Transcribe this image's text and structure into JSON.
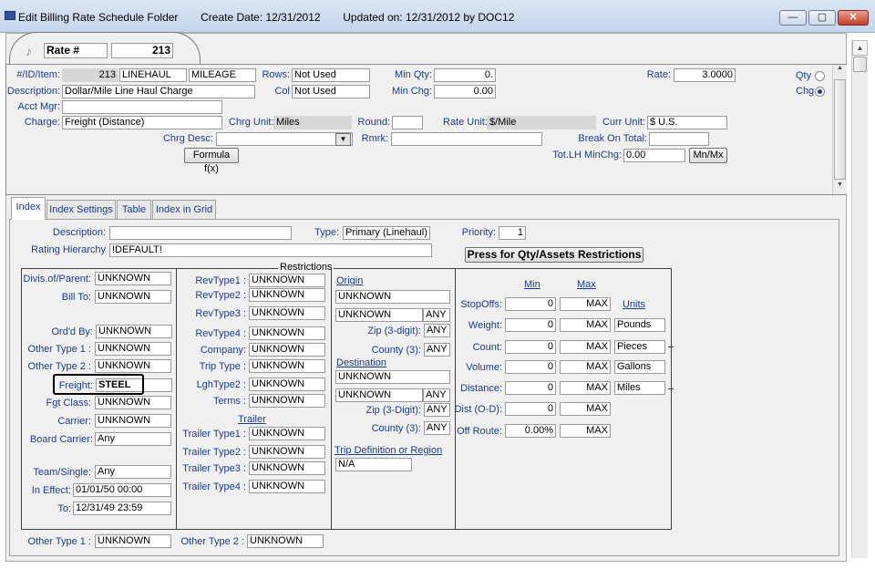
{
  "window": {
    "title": "Edit Billing Rate Schedule Folder",
    "create_date": "Create Date: 12/31/2012",
    "updated": "Updated on: 12/31/2012  by  DOC12",
    "min": "—",
    "max": "▢",
    "close": "✕"
  },
  "rate_tab": {
    "label": "Rate #",
    "value": "213"
  },
  "header": {
    "id_item_label": "#/ID/Item:",
    "id_num": "213",
    "id_name": "LINEHAUL",
    "item": "MILEAGE",
    "rows_label": "Rows:",
    "rows_value": "Not Used",
    "min_qty_label": "Min Qty:",
    "min_qty_value": "0.",
    "rate_label": "Rate:",
    "rate_value": "3.0000",
    "qty_label": "Qty",
    "chg_label": "Chg",
    "desc_label": "Description:",
    "desc_value": "Dollar/Mile Line Haul Charge",
    "col_label": "Col",
    "col_value": "Not Used",
    "min_chg_label": "Min Chg:",
    "min_chg_value": "0.00",
    "acct_mgr_label": "Acct Mgr:",
    "acct_mgr_value": "",
    "charge_label": "Charge:",
    "charge_value": "Freight (Distance)",
    "chrg_unit_label": "Chrg Unit:",
    "chrg_unit_value": "Miles",
    "round_label": "Round:",
    "round_value": "",
    "rate_unit_label": "Rate Unit:",
    "rate_unit_value": "$/Mile",
    "curr_unit_label": "Curr Unit:",
    "curr_unit_value": "$ U.S.",
    "chrg_desc_label": "Chrg Desc:",
    "chrg_desc_value": "",
    "rmrk_label": "Rmrk:",
    "rmrk_value": "",
    "break_on_total_label": "Break On Total:",
    "break_on_total_value": "",
    "formula_btn": "Formula f(x)",
    "tot_lh_label": "Tot.LH MinChg:",
    "tot_lh_value": "0.00",
    "mnmx_btn": "Mn/Mx"
  },
  "tabs": [
    "Index",
    "Index Settings",
    "Table",
    "Index in Grid"
  ],
  "index": {
    "description_label": "Description:",
    "description_value": "",
    "type_label": "Type:",
    "type_value": "Primary (Linehaul)",
    "priority_label": "Priority:",
    "priority_value": "1",
    "rating_hierarchy_label": "Rating Hierarchy",
    "rating_hierarchy_value": "!DEFAULT!",
    "press_btn": "Press for Qty/Assets Restrictions",
    "restrictions_label": "Restrictions",
    "col1": [
      {
        "label": "Divis.of/Parent:",
        "value": "UNKNOWN"
      },
      {
        "label": "Bill To:",
        "value": "UNKNOWN"
      },
      {
        "label": "Ord'd By:",
        "value": "UNKNOWN"
      },
      {
        "label": "Other Type 1 :",
        "value": "UNKNOWN"
      },
      {
        "label": "Other Type 2 :",
        "value": "UNKNOWN"
      },
      {
        "label": "Freight:",
        "value": "STEEL"
      },
      {
        "label": "Fgt Class:",
        "value": "UNKNOWN"
      },
      {
        "label": "Carrier:",
        "value": "UNKNOWN"
      },
      {
        "label": "Board Carrier:",
        "value": "Any"
      },
      {
        "label": "Team/Single:",
        "value": "Any"
      },
      {
        "label": "In Effect:",
        "value": "01/01/50 00:00"
      },
      {
        "label": "To:",
        "value": "12/31/49 23:59"
      }
    ],
    "col2": [
      {
        "label": "RevType1 :",
        "value": "UNKNOWN"
      },
      {
        "label": "RevType2 :",
        "value": "UNKNOWN"
      },
      {
        "label": "RevType3 :",
        "value": "UNKNOWN"
      },
      {
        "label": "RevType4 :",
        "value": "UNKNOWN"
      },
      {
        "label": "Company:",
        "value": "UNKNOWN"
      },
      {
        "label": "Trip Type :",
        "value": "UNKNOWN"
      },
      {
        "label": "LghType2 :",
        "value": "UNKNOWN"
      },
      {
        "label": "Terms :",
        "value": "UNKNOWN"
      }
    ],
    "trailer_label": "Trailer",
    "trailers": [
      {
        "label": "Trailer Type1 :",
        "value": "UNKNOWN"
      },
      {
        "label": "Trailer Type2 :",
        "value": "UNKNOWN"
      },
      {
        "label": "Trailer Type3 :",
        "value": "UNKNOWN"
      },
      {
        "label": "Trailer Type4 :",
        "value": "UNKNOWN"
      }
    ],
    "origin_label": "Origin",
    "origin_value": "UNKNOWN",
    "origin_sub": "UNKNOWN",
    "origin_sub_any": "ANY",
    "origin_zip_label": "Zip (3-digit):",
    "origin_zip_value": "ANY",
    "origin_county_label": "County (3):",
    "origin_county_value": "ANY",
    "dest_label": "Destination",
    "dest_value": "UNKNOWN",
    "dest_sub": "UNKNOWN",
    "dest_sub_any": "ANY",
    "dest_zip_label": "Zip (3-Digit):",
    "dest_zip_value": "ANY",
    "dest_county_label": "County (3):",
    "dest_county_value": "ANY",
    "trip_def_label": "Trip Definition or Region",
    "trip_def_value": "N/A",
    "min_label": "Min",
    "max_label": "Max",
    "units_label": "Units",
    "ranges": [
      {
        "label": "StopOffs:",
        "min": "0",
        "max": "MAX",
        "unit": ""
      },
      {
        "label": "Weight:",
        "min": "0",
        "max": "MAX",
        "unit": "Pounds"
      },
      {
        "label": "Count:",
        "min": "0",
        "max": "MAX",
        "unit": "Pieces"
      },
      {
        "label": "Volume:",
        "min": "0",
        "max": "MAX",
        "unit": "Gallons"
      },
      {
        "label": "Distance:",
        "min": "0",
        "max": "MAX",
        "unit": "Miles"
      },
      {
        "label": "Dist (O-D):",
        "min": "0",
        "max": "MAX",
        "unit": ""
      },
      {
        "label": "Off Route:",
        "min": "0.00%",
        "max": "MAX",
        "unit": ""
      }
    ],
    "bottom_other1_label": "Other Type 1 :",
    "bottom_other1_value": "UNKNOWN",
    "bottom_other2_label": "Other Type 2 :",
    "bottom_other2_value": "UNKNOWN"
  }
}
